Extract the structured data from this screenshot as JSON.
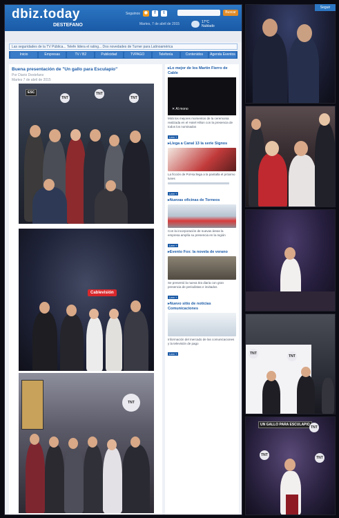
{
  "site": {
    "logo": "dbiz.today",
    "logo_sub": "DESTEFANO",
    "social_label": "Seguinos",
    "social_icons": [
      "rss-icon",
      "facebook-icon",
      "twitter-icon"
    ],
    "search_button": "Buscar",
    "dateline": "Martes, 7 de abril de 2015",
    "weather_line1": "17°C",
    "weather_line2": "Nublado",
    "ticker": "Las seguridades de la TV Pública... Telefe lidera el rating... Dos novedades de Turner para Latinoamérica",
    "nav": [
      "Inicio",
      "Empresas",
      "TV / B2",
      "Publicidad",
      "TVPAGO",
      "Telefonía",
      "Contenidos",
      "Agenda Eventos"
    ]
  },
  "article": {
    "title": "Buena presentación de \"Un gallo para Esculapio\"",
    "meta_author": "Por Diario Destefano",
    "meta_date": "Martes 7 de abril de 2015"
  },
  "sidebar": {
    "video_heading": "Lo mejor de los Martin Fierro de Cable",
    "video_label": "Al mono",
    "video_text": "Mirá los mejores momentos de la ceremonia realizada en el Hotel Hilton con la presencia de todos los nominados",
    "more_label": "Leer +",
    "block2_heading": "Llega a Canal 13 la serie Signos",
    "block2_text": "La ficción de Pol-ka llega a la pantalla el próximo lunes",
    "block3_heading": "Nuevas oficinas de Torneos",
    "block3_text": "Con la incorporación de nuevas áreas la empresa amplía su presencia en la región",
    "block4_heading": "Evento Fox: la novela de verano",
    "block4_text": "Se presentó la nueva tira diaria con gran presencia de periodistas e invitados",
    "block5_heading": "Nuevo sitio de noticias Comunicaciones",
    "block5_text": "Información del mercado de las comunicaciones y la televisión de pago"
  },
  "right_photos": {
    "corner_button": "Seguir",
    "badge": "UN GALLO PARA ESCULAPIO",
    "tnt": "TNT",
    "cable_badge": "Cablevisión"
  }
}
